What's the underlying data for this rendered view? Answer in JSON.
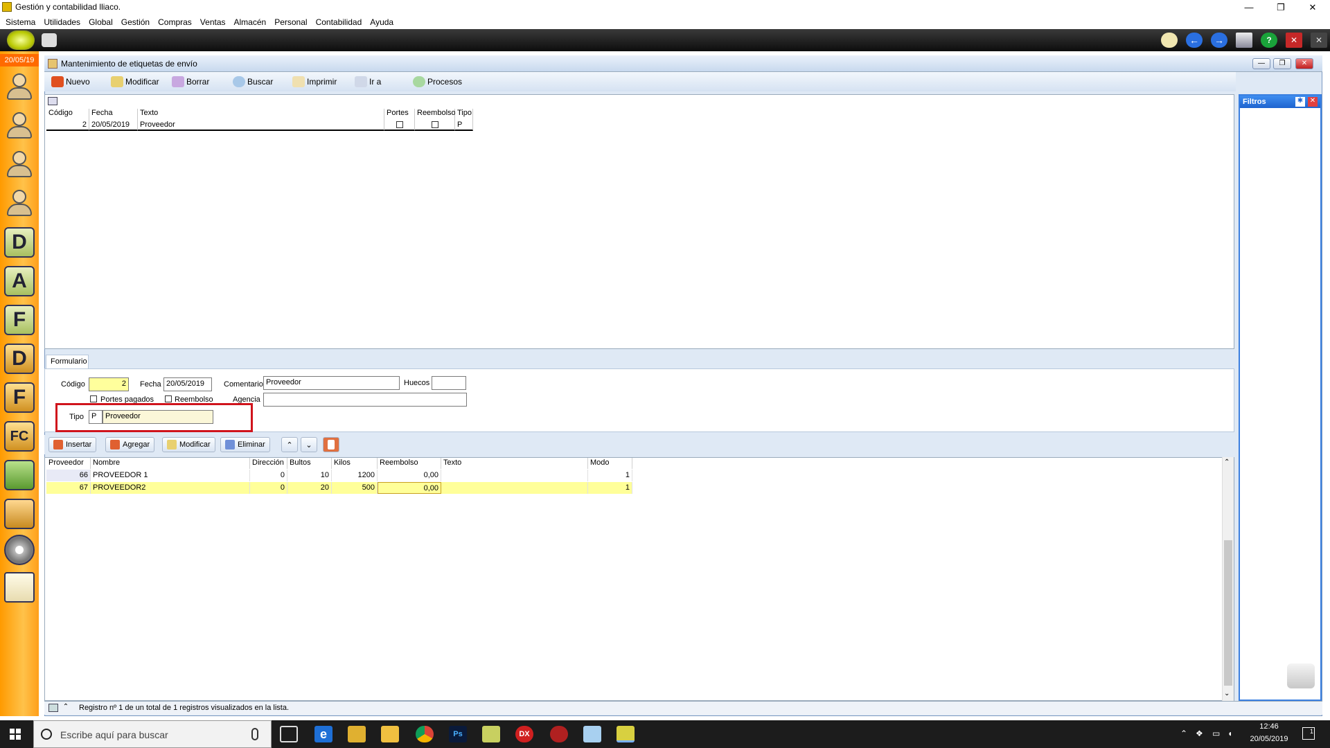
{
  "window": {
    "title": "Gestión y contabilidad lliaco."
  },
  "menu": [
    "Sistema",
    "Utilidades",
    "Global",
    "Gestión",
    "Compras",
    "Ventas",
    "Almacén",
    "Personal",
    "Contabilidad",
    "Ayuda"
  ],
  "sidebar": {
    "date": "20/05/19",
    "letters": [
      "D",
      "A",
      "F",
      "D",
      "F",
      "FC"
    ]
  },
  "subwindow": {
    "title": "Mantenimiento de etiquetas de envío"
  },
  "toolbar": {
    "nuevo": "Nuevo",
    "modificar": "Modificar",
    "borrar": "Borrar",
    "buscar": "Buscar",
    "imprimir": "Imprimir",
    "ira": "Ir a",
    "procesos": "Procesos"
  },
  "grid1": {
    "headers": {
      "codigo": "Código",
      "fecha": "Fecha",
      "texto": "Texto",
      "portes": "Portes",
      "reembolso": "Reembolso",
      "tipo": "Tipo"
    },
    "row": {
      "codigo": "2",
      "fecha": "20/05/2019",
      "texto": "Proveedor",
      "tipo": "P"
    }
  },
  "filtros": {
    "title": "Filtros"
  },
  "form": {
    "tab": "Formulario",
    "codigo_label": "Código",
    "codigo_value": "2",
    "fecha_label": "Fecha",
    "fecha_value": "20/05/2019",
    "comentario_label": "Comentario",
    "comentario_value": "Proveedor",
    "huecos_label": "Huecos",
    "huecos_value": "",
    "portes_label": "Portes pagados",
    "reembolso_label": "Reembolso",
    "agencia_label": "Agencia",
    "agencia_value": "",
    "tipo_label": "Tipo",
    "tipo_code": "P",
    "tipo_value": "Proveedor"
  },
  "lowertoolbar": {
    "insertar": "Insertar",
    "agregar": "Agregar",
    "modificar": "Modificar",
    "eliminar": "Eliminar"
  },
  "grid2": {
    "headers": {
      "proveedor": "Proveedor",
      "nombre": "Nombre",
      "direccion": "Dirección",
      "bultos": "Bultos",
      "kilos": "Kilos",
      "reembolso": "Reembolso",
      "texto": "Texto",
      "modo": "Modo"
    },
    "rows": [
      {
        "proveedor": "66",
        "nombre": "PROVEEDOR 1",
        "direccion": "0",
        "bultos": "10",
        "kilos": "1200",
        "reembolso": "0,00",
        "texto": "",
        "modo": "1"
      },
      {
        "proveedor": "67",
        "nombre": "PROVEEDOR2",
        "direccion": "0",
        "bultos": "20",
        "kilos": "500",
        "reembolso": "0,00",
        "texto": "",
        "modo": "1"
      }
    ]
  },
  "status": {
    "text": "Registro nº 1 de un total de 1 registros visualizados en la lista."
  },
  "taskbar": {
    "search_placeholder": "Escribe aquí para buscar",
    "time": "12:46",
    "date": "20/05/2019",
    "notifications": "1"
  },
  "colors": {
    "highlight": "#d0141c",
    "selected_row": "#ffff99",
    "sidebar": "#ff9a00",
    "filtros_header": "#1d63cf"
  }
}
